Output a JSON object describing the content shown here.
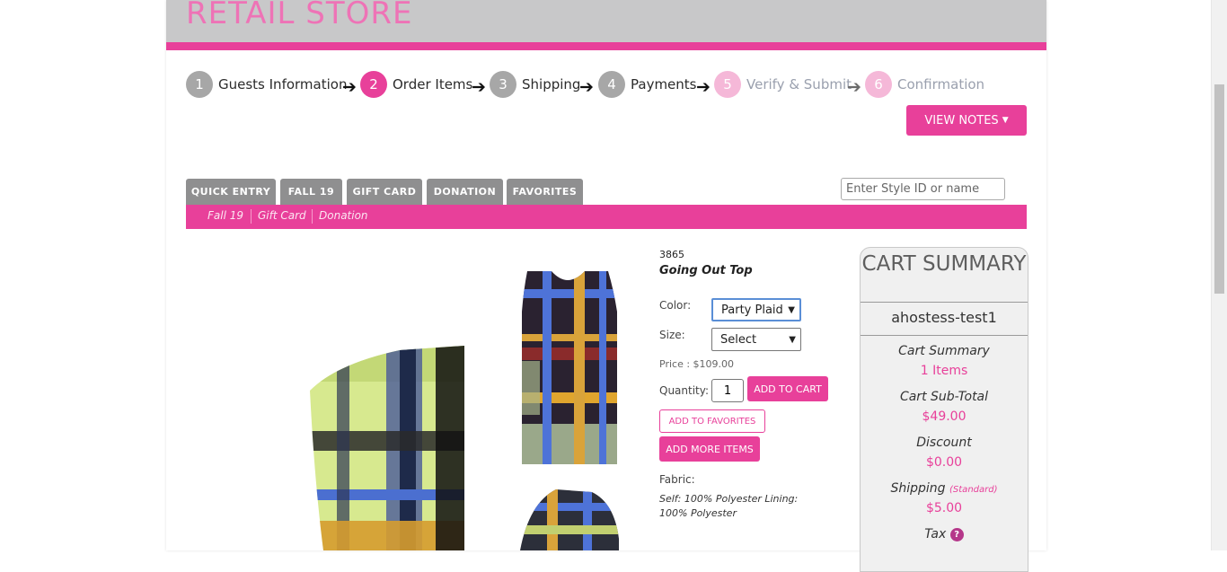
{
  "header": {
    "title": "RETAIL STORE"
  },
  "steps": [
    {
      "num": "1",
      "label": "Guests Information"
    },
    {
      "num": "2",
      "label": "Order Items"
    },
    {
      "num": "3",
      "label": "Shipping"
    },
    {
      "num": "4",
      "label": "Payments"
    },
    {
      "num": "5",
      "label": "Verify & Submit"
    },
    {
      "num": "6",
      "label": "Confirmation"
    }
  ],
  "view_notes_label": "VIEW NOTES",
  "tabs": [
    "QUICK ENTRY",
    "FALL 19",
    "GIFT CARD",
    "DONATION",
    "FAVORITES"
  ],
  "search": {
    "placeholder": "Enter Style ID or name"
  },
  "subnav": [
    "Fall 19",
    "Gift Card",
    "Donation"
  ],
  "product": {
    "style_id": "3865",
    "name": "Going Out Top",
    "color_label": "Color:",
    "color_value": "Party Plaid",
    "size_label": "Size:",
    "size_value": "Select",
    "price": "Price : $109.00",
    "quantity_label": "Quantity:",
    "quantity_value": "1",
    "add_to_cart": "ADD TO CART",
    "add_to_favorites": "ADD TO FAVORITES",
    "add_more_items": "ADD MORE ITEMS",
    "fabric_label": "Fabric:",
    "fabric_text": "Self: 100% Polyester Lining: 100% Polyester"
  },
  "cart": {
    "title": "CART SUMMARY",
    "user": "ahostess-test1",
    "summary_label": "Cart Summary",
    "items": "1 Items",
    "subtotal_label": "Cart Sub-Total",
    "subtotal": "$49.00",
    "discount_label": "Discount",
    "discount": "$0.00",
    "shipping_label": "Shipping",
    "shipping_type": "(Standard)",
    "shipping": "$5.00",
    "tax_label": "Tax",
    "tax_help": "?"
  },
  "colors": {
    "accent": "#e8409a",
    "header_bg": "#c8c8c9",
    "tab_bg": "#8f8f90"
  },
  "icons": [
    "arrow-right-icon",
    "chevron-down-icon",
    "question-icon",
    "caret-down-icon"
  ]
}
